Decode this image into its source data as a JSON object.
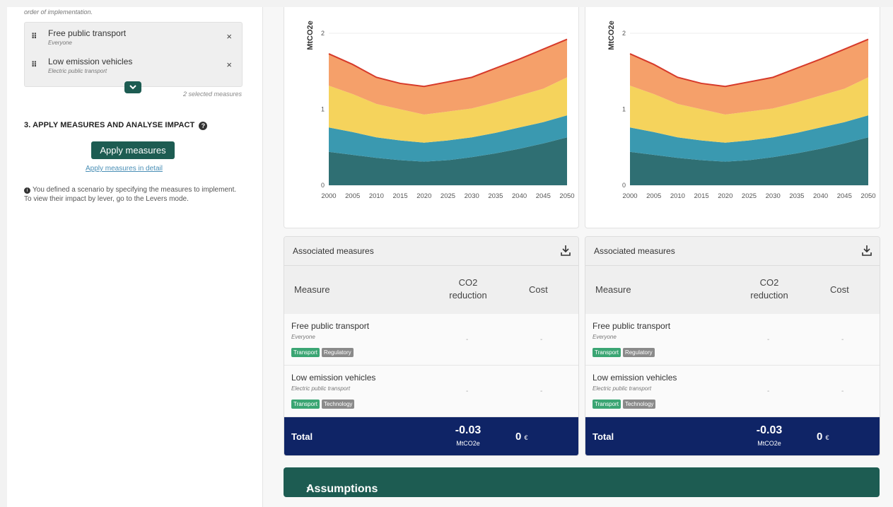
{
  "sidebar": {
    "order_note": "order of implementation.",
    "selected_measures": [
      {
        "name": "Free public transport",
        "sub": "Everyone"
      },
      {
        "name": "Low emission vehicles",
        "sub": "Electric public transport"
      }
    ],
    "remove_glyph": "×",
    "drag_glyph": "⠿",
    "chevron_glyph": "⌄",
    "selected_count": "2 selected measures",
    "section_title": "3. APPLY MEASURES AND ANALYSE IMPACT",
    "apply_button": "Apply measures",
    "apply_detail_link": "Apply measures in detail",
    "info_text": "You defined a scenario by specifying the measures to implement. To view their impact by lever, go to the Levers mode."
  },
  "chart_data": [
    {
      "type": "area",
      "ylabel": "MtCO2e",
      "ylim": [
        0,
        2
      ],
      "yticks": [
        "0",
        "1",
        "2"
      ],
      "x": [
        2000,
        2005,
        2010,
        2015,
        2020,
        2025,
        2030,
        2035,
        2040,
        2045,
        2050
      ],
      "xticks": [
        "2000",
        "2005",
        "2010",
        "2015",
        "2020",
        "2025",
        "2030",
        "2035",
        "2040",
        "2045",
        "2050"
      ],
      "series": [
        {
          "color": "#2f6f73",
          "values": [
            0.44,
            0.4,
            0.36,
            0.33,
            0.31,
            0.33,
            0.37,
            0.42,
            0.48,
            0.55,
            0.63
          ]
        },
        {
          "color": "#3a99b0",
          "values": [
            0.32,
            0.3,
            0.27,
            0.26,
            0.25,
            0.26,
            0.26,
            0.27,
            0.28,
            0.28,
            0.29
          ]
        },
        {
          "color": "#f5d35c",
          "values": [
            0.55,
            0.5,
            0.44,
            0.41,
            0.37,
            0.38,
            0.38,
            0.4,
            0.42,
            0.44,
            0.5
          ]
        },
        {
          "color": "#f5a06a",
          "values": [
            0.42,
            0.39,
            0.35,
            0.34,
            0.37,
            0.39,
            0.41,
            0.45,
            0.48,
            0.52,
            0.5
          ]
        }
      ],
      "total_line_color": "#d63a2a"
    },
    {
      "type": "area",
      "ylabel": "MtCO2e",
      "ylim": [
        0,
        2
      ],
      "yticks": [
        "0",
        "1",
        "2"
      ],
      "x": [
        2000,
        2005,
        2010,
        2015,
        2020,
        2025,
        2030,
        2035,
        2040,
        2045,
        2050
      ],
      "xticks": [
        "2000",
        "2005",
        "2010",
        "2015",
        "2020",
        "2025",
        "2030",
        "2035",
        "2040",
        "2045",
        "2050"
      ],
      "series": [
        {
          "color": "#2f6f73",
          "values": [
            0.44,
            0.4,
            0.36,
            0.33,
            0.31,
            0.33,
            0.37,
            0.42,
            0.48,
            0.55,
            0.63
          ]
        },
        {
          "color": "#3a99b0",
          "values": [
            0.32,
            0.3,
            0.27,
            0.26,
            0.25,
            0.26,
            0.26,
            0.27,
            0.28,
            0.28,
            0.29
          ]
        },
        {
          "color": "#f5d35c",
          "values": [
            0.55,
            0.5,
            0.44,
            0.41,
            0.37,
            0.38,
            0.38,
            0.4,
            0.42,
            0.44,
            0.5
          ]
        },
        {
          "color": "#f5a06a",
          "values": [
            0.42,
            0.39,
            0.35,
            0.34,
            0.37,
            0.39,
            0.41,
            0.45,
            0.48,
            0.52,
            0.5
          ]
        }
      ],
      "total_line_color": "#d63a2a"
    }
  ],
  "tables": [
    {
      "title": "Associated measures",
      "download_icon": "download-icon",
      "headers": {
        "measure": "Measure",
        "co2_line1": "CO2",
        "co2_line2": "reduction",
        "cost": "Cost"
      },
      "rows": [
        {
          "name": "Free public transport",
          "sub": "Everyone",
          "tags": [
            "Transport",
            "Regulatory"
          ],
          "co2": "-",
          "cost": "-"
        },
        {
          "name": "Low emission vehicles",
          "sub": "Electric public transport",
          "tags": [
            "Transport",
            "Technology"
          ],
          "co2": "-",
          "cost": "-"
        }
      ],
      "total": {
        "label": "Total",
        "value": "-0.03",
        "unit": "MtCO2e",
        "cost": "0",
        "currency": "€"
      }
    },
    {
      "title": "Associated measures",
      "download_icon": "download-icon",
      "headers": {
        "measure": "Measure",
        "co2_line1": "CO2",
        "co2_line2": "reduction",
        "cost": "Cost"
      },
      "rows": [
        {
          "name": "Free public transport",
          "sub": "Everyone",
          "tags": [
            "Transport",
            "Regulatory"
          ],
          "co2": "-",
          "cost": "-"
        },
        {
          "name": "Low emission vehicles",
          "sub": "Electric public transport",
          "tags": [
            "Transport",
            "Technology"
          ],
          "co2": "-",
          "cost": "-"
        }
      ],
      "total": {
        "label": "Total",
        "value": "-0.03",
        "unit": "MtCO2e",
        "cost": "0",
        "currency": "€"
      }
    }
  ],
  "assumptions": {
    "label": "Assumptions",
    "chevron": "›"
  },
  "colors": {
    "brand": "#1d5c52",
    "total_bg": "#0f2466",
    "tag_green": "#3aa573",
    "tag_gray": "#8a8a8a"
  }
}
